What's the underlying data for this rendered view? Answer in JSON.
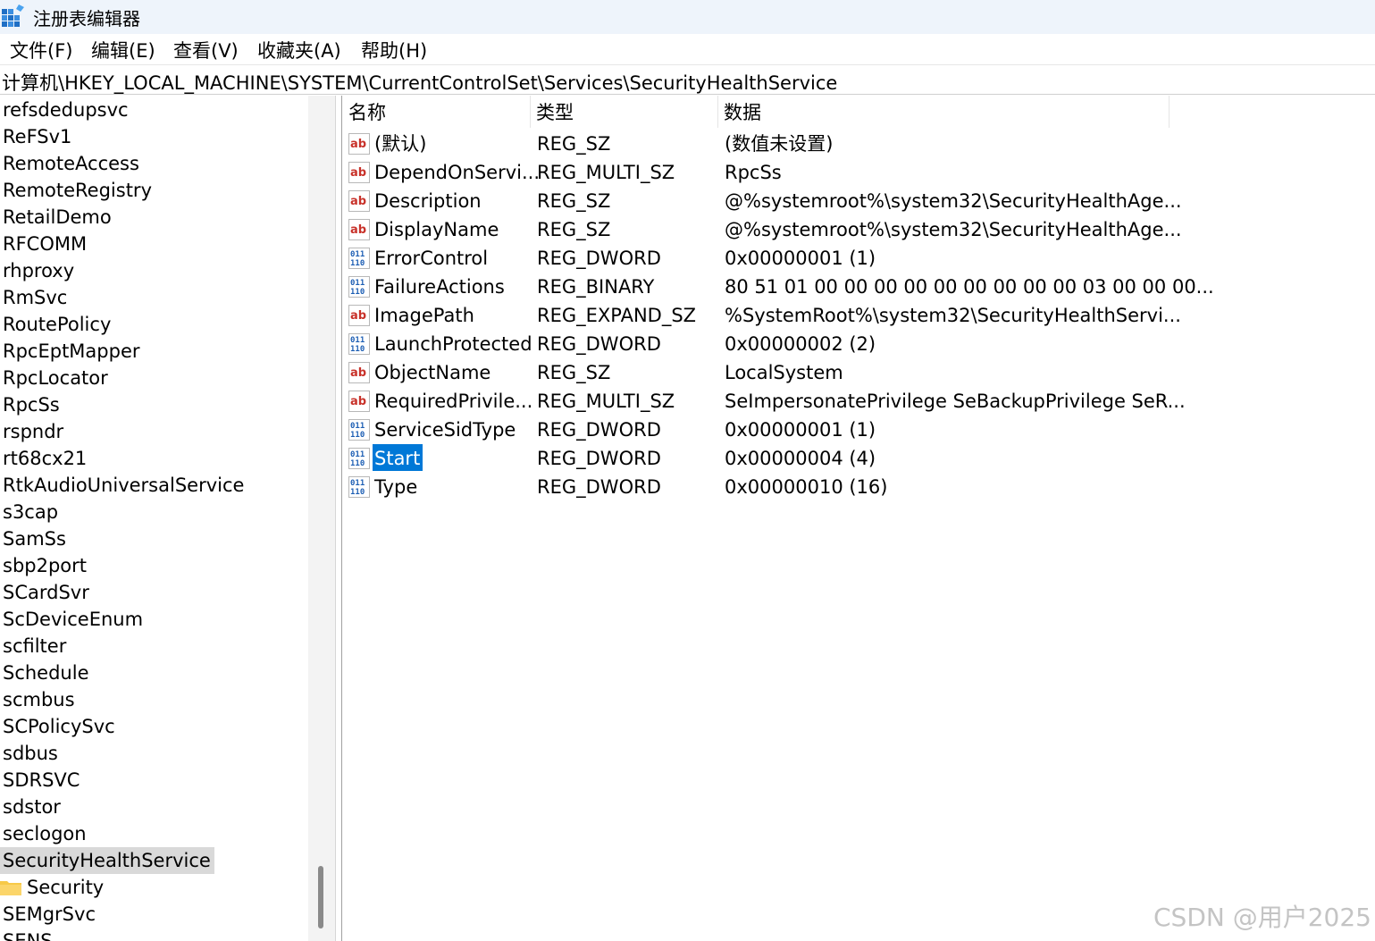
{
  "window": {
    "title": "注册表编辑器",
    "icon": "registry-editor-icon"
  },
  "menu": [
    {
      "label": "文件(F)"
    },
    {
      "label": "编辑(E)"
    },
    {
      "label": "查看(V)"
    },
    {
      "label": "收藏夹(A)"
    },
    {
      "label": "帮助(H)"
    }
  ],
  "address": "计算机\\HKEY_LOCAL_MACHINE\\SYSTEM\\CurrentControlSet\\Services\\SecurityHealthService",
  "tree": {
    "items": [
      {
        "label": "refsdedupsvc"
      },
      {
        "label": "ReFSv1"
      },
      {
        "label": "RemoteAccess"
      },
      {
        "label": "RemoteRegistry"
      },
      {
        "label": "RetailDemo"
      },
      {
        "label": "RFCOMM"
      },
      {
        "label": "rhproxy"
      },
      {
        "label": "RmSvc"
      },
      {
        "label": "RoutePolicy"
      },
      {
        "label": "RpcEptMapper"
      },
      {
        "label": "RpcLocator"
      },
      {
        "label": "RpcSs"
      },
      {
        "label": "rspndr"
      },
      {
        "label": "rt68cx21"
      },
      {
        "label": "RtkAudioUniversalService"
      },
      {
        "label": "s3cap"
      },
      {
        "label": "SamSs"
      },
      {
        "label": "sbp2port"
      },
      {
        "label": "SCardSvr"
      },
      {
        "label": "ScDeviceEnum"
      },
      {
        "label": "scfilter"
      },
      {
        "label": "Schedule"
      },
      {
        "label": "scmbus"
      },
      {
        "label": "SCPolicySvc"
      },
      {
        "label": "sdbus"
      },
      {
        "label": "SDRSVC"
      },
      {
        "label": "sdstor"
      },
      {
        "label": "seclogon"
      },
      {
        "label": "SecurityHealthService",
        "selected": true
      },
      {
        "label": "Security",
        "child": true
      },
      {
        "label": "SEMgrSvc"
      },
      {
        "label": "SENS"
      }
    ]
  },
  "columns": {
    "name": "名称",
    "type": "类型",
    "data": "数据"
  },
  "values": [
    {
      "name": "(默认)",
      "type": "REG_SZ",
      "data": "(数值未设置)",
      "icon": "string-value-icon"
    },
    {
      "name": "DependOnServi...",
      "type": "REG_MULTI_SZ",
      "data": "RpcSs",
      "icon": "string-value-icon"
    },
    {
      "name": "Description",
      "type": "REG_SZ",
      "data": "@%systemroot%\\system32\\SecurityHealthAge...",
      "icon": "string-value-icon"
    },
    {
      "name": "DisplayName",
      "type": "REG_SZ",
      "data": "@%systemroot%\\system32\\SecurityHealthAge...",
      "icon": "string-value-icon"
    },
    {
      "name": "ErrorControl",
      "type": "REG_DWORD",
      "data": "0x00000001 (1)",
      "icon": "binary-value-icon"
    },
    {
      "name": "FailureActions",
      "type": "REG_BINARY",
      "data": "80 51 01 00 00 00 00 00 00 00 00 00 03 00 00 00...",
      "icon": "binary-value-icon"
    },
    {
      "name": "ImagePath",
      "type": "REG_EXPAND_SZ",
      "data": "%SystemRoot%\\system32\\SecurityHealthServi...",
      "icon": "string-value-icon"
    },
    {
      "name": "LaunchProtected",
      "type": "REG_DWORD",
      "data": "0x00000002 (2)",
      "icon": "binary-value-icon"
    },
    {
      "name": "ObjectName",
      "type": "REG_SZ",
      "data": "LocalSystem",
      "icon": "string-value-icon"
    },
    {
      "name": "RequiredPrivile...",
      "type": "REG_MULTI_SZ",
      "data": "SeImpersonatePrivilege SeBackupPrivilege SeR...",
      "icon": "string-value-icon"
    },
    {
      "name": "ServiceSidType",
      "type": "REG_DWORD",
      "data": "0x00000001 (1)",
      "icon": "binary-value-icon"
    },
    {
      "name": "Start",
      "type": "REG_DWORD",
      "data": "0x00000004 (4)",
      "icon": "binary-value-icon",
      "selected": true
    },
    {
      "name": "Type",
      "type": "REG_DWORD",
      "data": "0x00000010 (16)",
      "icon": "binary-value-icon"
    }
  ],
  "watermark": "CSDN @用户2025",
  "colors": {
    "selection": "#0078d7",
    "tree_selection": "#d9d9d9",
    "string_icon": "#c8322a",
    "binary_icon": "#1e5fb4"
  }
}
